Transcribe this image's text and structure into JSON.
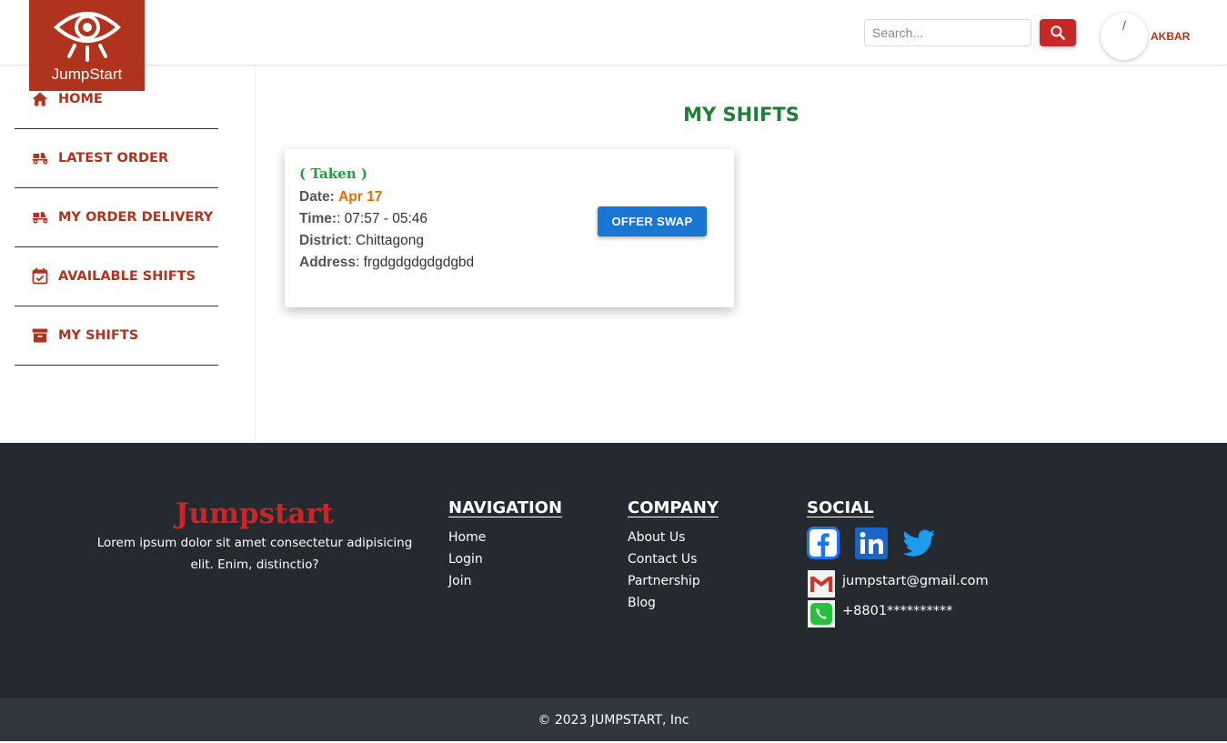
{
  "header": {
    "logo_text": "JumpStart",
    "search_placeholder": "Search...",
    "avatar_text": "/",
    "username": "AKBAR"
  },
  "sidebar": {
    "items": [
      {
        "label": "HOME",
        "icon": "home-icon"
      },
      {
        "label": "LATEST ORDER",
        "icon": "moped-icon"
      },
      {
        "label": "MY ORDER DELIVERY",
        "icon": "moped-icon"
      },
      {
        "label": "AVAILABLE SHIFTS",
        "icon": "event-available-icon"
      },
      {
        "label": "MY SHIFTS",
        "icon": "archive-icon"
      }
    ]
  },
  "main": {
    "title": "MY SHIFTS",
    "shift": {
      "status": "( Taken )",
      "date_label": "Date:",
      "date_value": "Apr 17",
      "time_label": "Time:",
      "time_value": ": 07:57 - 05:46",
      "district_label": "District",
      "district_value": ": Chittagong",
      "address_label": "Address",
      "address_value": ": frgdgdgdgdgdgbd",
      "button_label": "OFFER SWAP"
    }
  },
  "footer": {
    "brand": "Jumpstart",
    "description": "Lorem ipsum dolor sit amet consectetur adipisicing elit. Enim, distinctio?",
    "navigation": {
      "title": "NAVIGATION",
      "links": [
        "Home",
        "Login",
        "Join"
      ]
    },
    "company": {
      "title": "COMPANY",
      "links": [
        "About Us",
        "Contact Us",
        "Partnership",
        "Blog"
      ]
    },
    "social": {
      "title": "SOCIAL",
      "icons": [
        "facebook-icon",
        "linkedin-icon",
        "twitter-icon"
      ],
      "email": "jumpstart@gmail.com",
      "phone": "+8801**********"
    },
    "copyright": "© 2023 JUMPSTART, Inc"
  },
  "colors": {
    "brand": "#b0341d",
    "green": "#1e7e34",
    "blue": "#1976d2",
    "footer_bg": "#242a30"
  }
}
